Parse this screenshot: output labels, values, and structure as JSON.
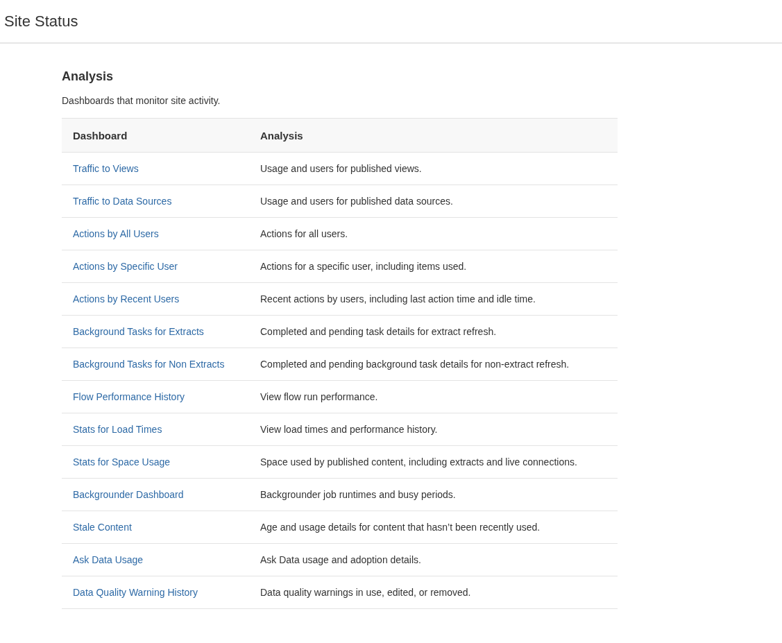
{
  "page_title": "Site Status",
  "section": {
    "title": "Analysis",
    "description": "Dashboards that monitor site activity."
  },
  "table": {
    "columns": [
      "Dashboard",
      "Analysis"
    ],
    "rows": [
      {
        "dashboard": "Traffic to Views",
        "analysis": "Usage and users for published views."
      },
      {
        "dashboard": "Traffic to Data Sources",
        "analysis": "Usage and users for published data sources."
      },
      {
        "dashboard": "Actions by All Users",
        "analysis": "Actions for all users."
      },
      {
        "dashboard": "Actions by Specific User",
        "analysis": "Actions for a specific user, including items used."
      },
      {
        "dashboard": "Actions by Recent Users",
        "analysis": "Recent actions by users, including last action time and idle time."
      },
      {
        "dashboard": "Background Tasks for Extracts",
        "analysis": "Completed and pending task details for extract refresh."
      },
      {
        "dashboard": "Background Tasks for Non Extracts",
        "analysis": "Completed and pending background task details for non-extract refresh."
      },
      {
        "dashboard": "Flow Performance History",
        "analysis": "View flow run performance."
      },
      {
        "dashboard": "Stats for Load Times",
        "analysis": "View load times and performance history."
      },
      {
        "dashboard": "Stats for Space Usage",
        "analysis": "Space used by published content, including extracts and live connections."
      },
      {
        "dashboard": "Backgrounder Dashboard",
        "analysis": "Backgrounder job runtimes and busy periods."
      },
      {
        "dashboard": "Stale Content",
        "analysis": "Age and usage details for content that hasn’t been recently used."
      },
      {
        "dashboard": "Ask Data Usage",
        "analysis": "Ask Data usage and adoption details."
      },
      {
        "dashboard": "Data Quality Warning History",
        "analysis": "Data quality warnings in use, edited, or removed."
      }
    ]
  }
}
